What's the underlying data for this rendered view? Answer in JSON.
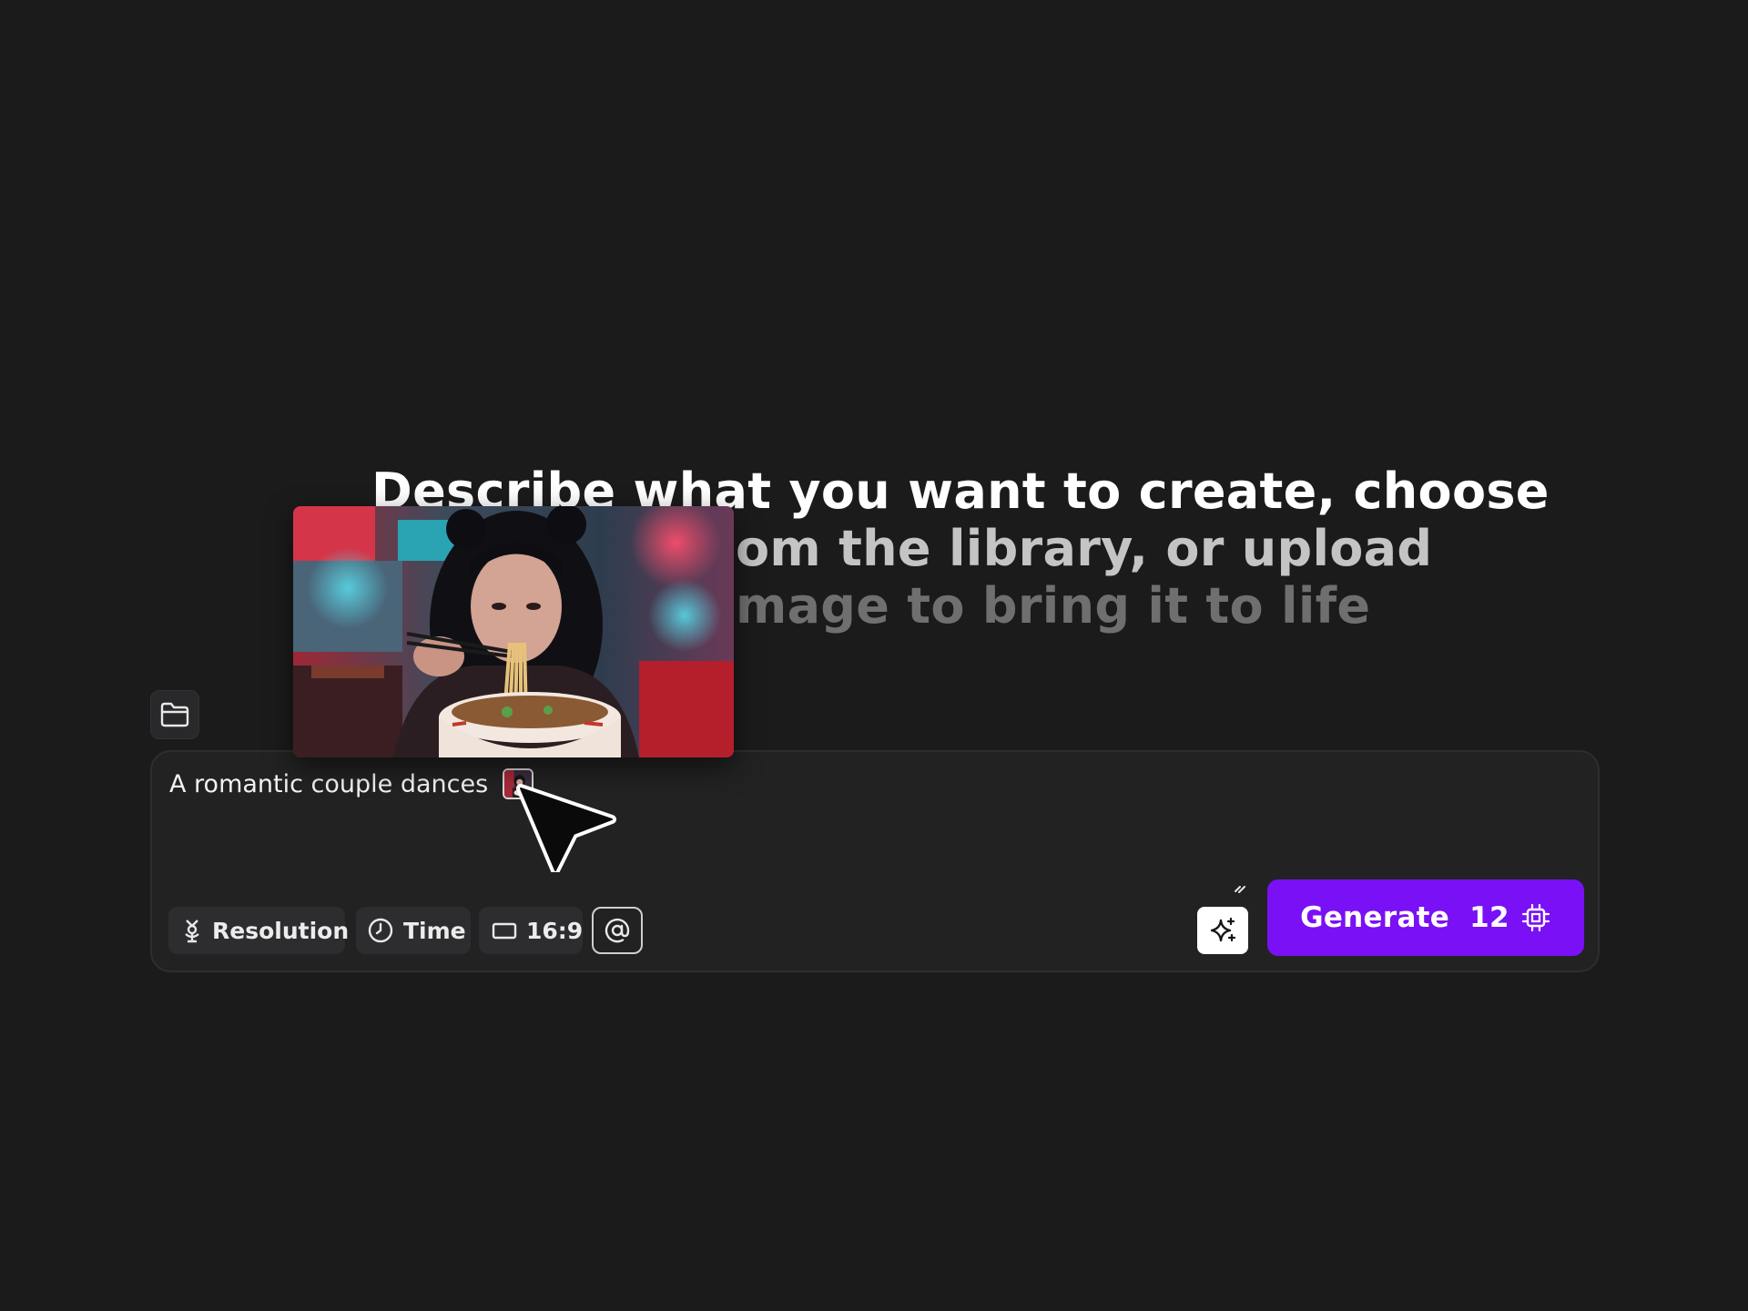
{
  "heading": {
    "line1": "Describe what you want to create, choose",
    "line2": "om the library, or upload",
    "line3": "mage to bring it to life"
  },
  "library_button": {
    "icon": "folder-icon"
  },
  "prompt": {
    "text": "A romantic couple dances",
    "attached_image": "reference-image-thumbnail"
  },
  "options": {
    "resolution_label": "Resolution",
    "time_label": "Time",
    "aspect_label": "16:9",
    "mention_icon": "at-icon"
  },
  "generate": {
    "label": "Generate",
    "cost": "12",
    "cost_icon": "chip-icon"
  },
  "colors": {
    "background": "#1b1b1c",
    "panel": "#222223",
    "accent": "#7a10f5"
  }
}
